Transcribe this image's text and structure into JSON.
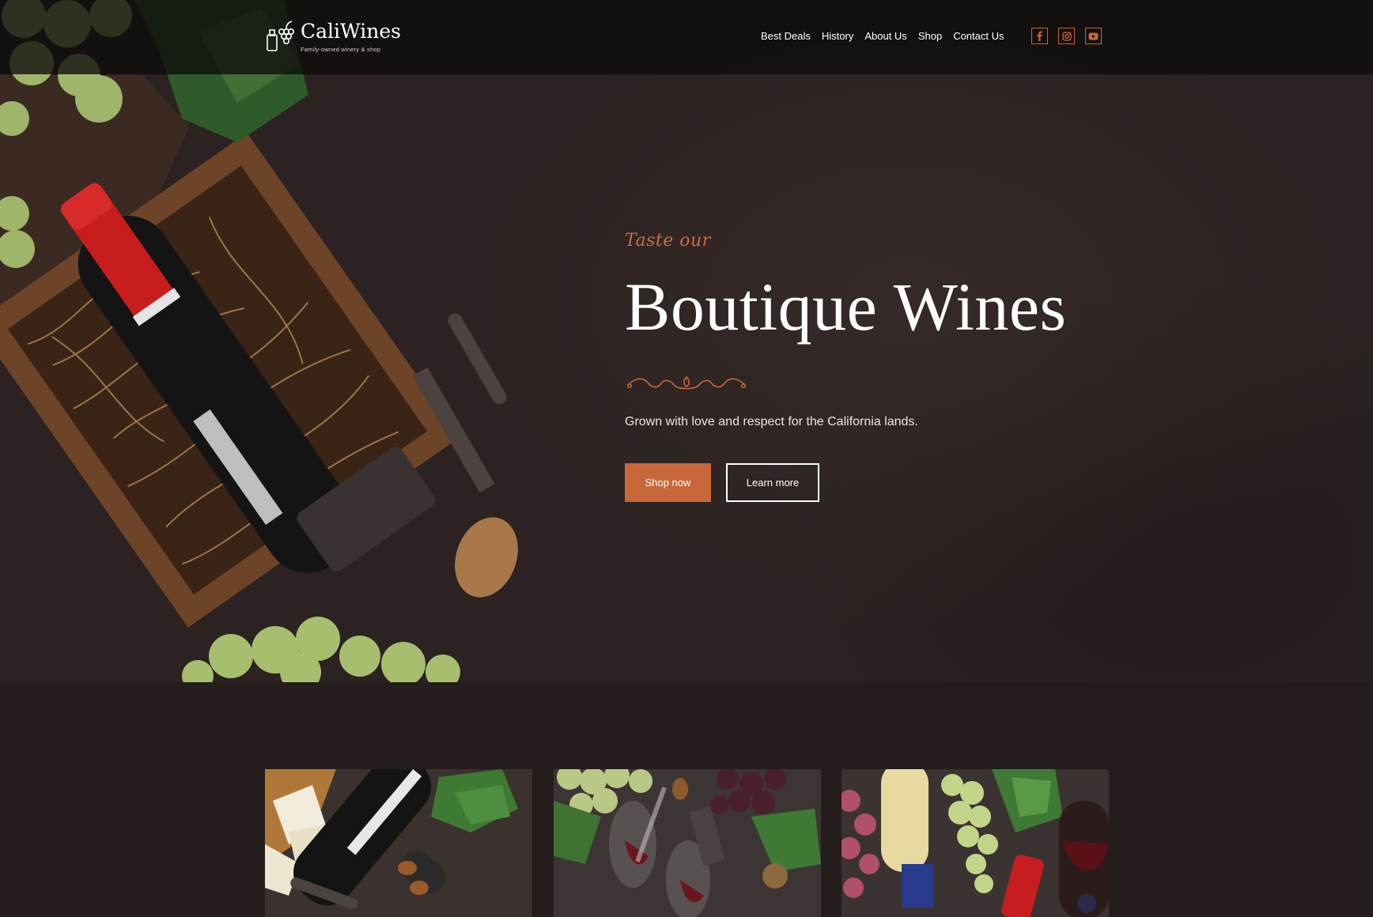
{
  "brand": {
    "name": "CaliWines",
    "tagline": "Family-owned winery & shop"
  },
  "nav": {
    "items": [
      {
        "label": "Best Deals"
      },
      {
        "label": "History"
      },
      {
        "label": "About Us"
      },
      {
        "label": "Shop"
      },
      {
        "label": "Contact Us"
      }
    ]
  },
  "social": {
    "icons": [
      "facebook-icon",
      "instagram-icon",
      "youtube-icon"
    ]
  },
  "hero": {
    "kicker": "Taste our",
    "title": "Boutique Wines",
    "subtitle": "Grown with love and respect for the California lands.",
    "primary_button": "Shop now",
    "secondary_button": "Learn more"
  },
  "colors": {
    "accent": "#c8683a",
    "hero_bg": "#2b2221",
    "page_bg": "#241d1c"
  }
}
